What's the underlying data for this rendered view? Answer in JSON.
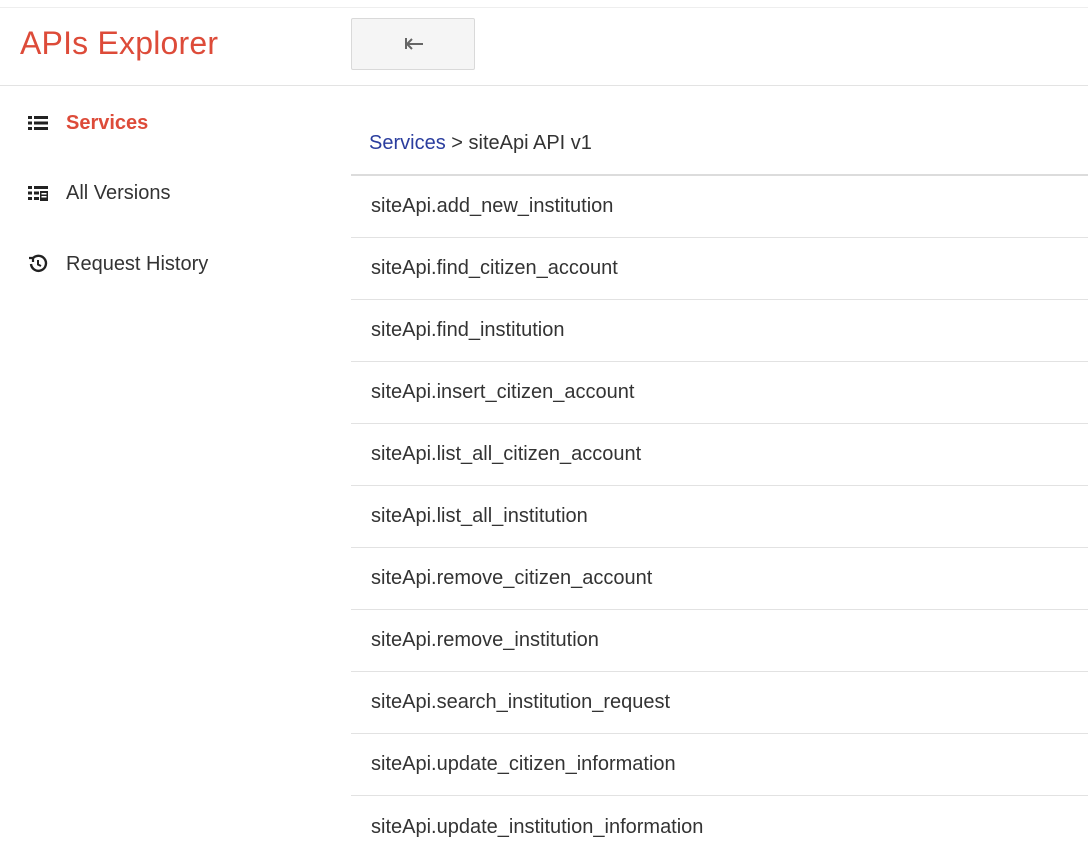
{
  "app": {
    "title": "APIs Explorer"
  },
  "header": {
    "back_icon": "back-arrow-icon"
  },
  "sidebar": {
    "items": [
      {
        "label": "Services",
        "icon": "list-icon",
        "active": true
      },
      {
        "label": "All Versions",
        "icon": "versions-icon",
        "active": false
      },
      {
        "label": "Request History",
        "icon": "history-icon",
        "active": false
      }
    ]
  },
  "breadcrumb": {
    "link": "Services",
    "separator": ">",
    "current": "siteApi API v1"
  },
  "methods": [
    "siteApi.add_new_institution",
    "siteApi.find_citizen_account",
    "siteApi.find_institution",
    "siteApi.insert_citizen_account",
    "siteApi.list_all_citizen_account",
    "siteApi.list_all_institution",
    "siteApi.remove_citizen_account",
    "siteApi.remove_institution",
    "siteApi.search_institution_request",
    "siteApi.update_citizen_information",
    "siteApi.update_institution_information"
  ],
  "colors": {
    "brand": "#dd4b39",
    "link": "#2a3d9e",
    "text": "#333333"
  }
}
